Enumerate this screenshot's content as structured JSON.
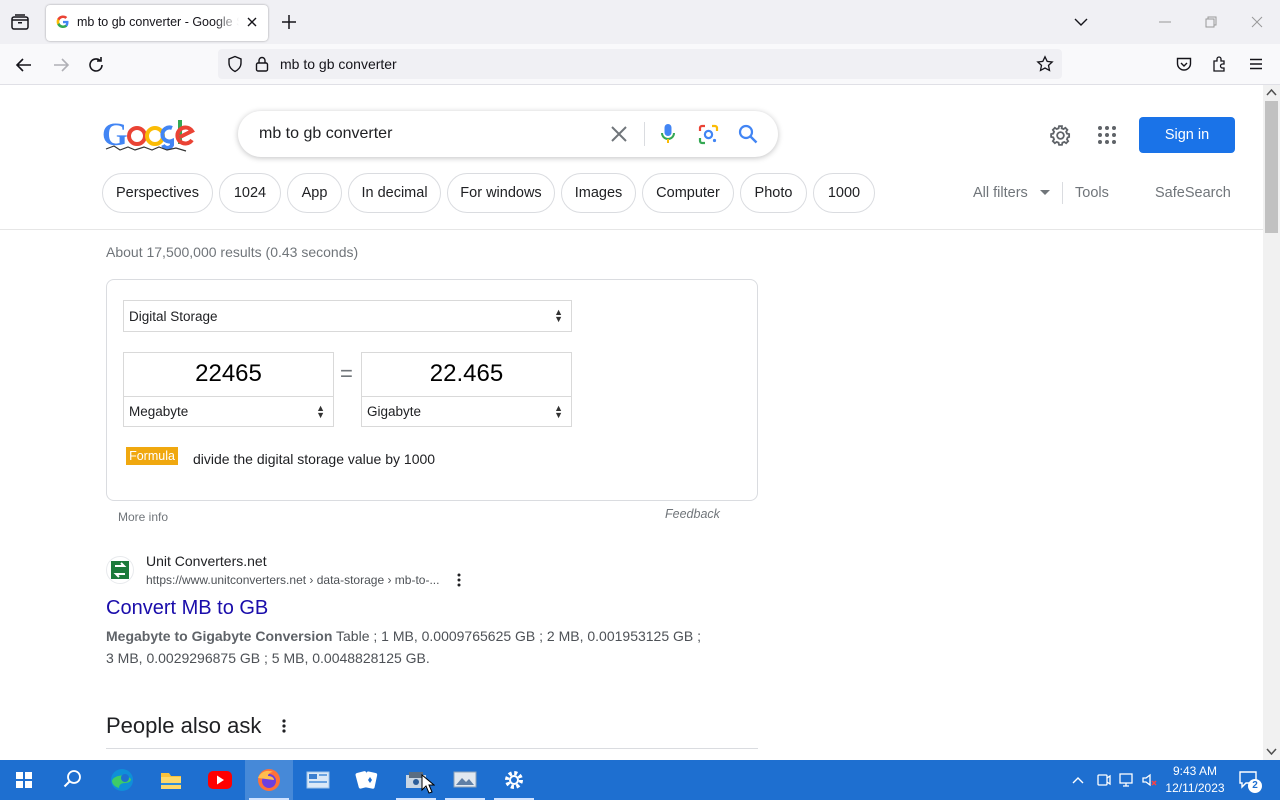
{
  "browser": {
    "tab_title": "mb to gb converter - Google Search",
    "url": "mb to gb converter"
  },
  "google": {
    "query": "mb to gb converter",
    "sign_in": "Sign in",
    "chips": [
      "Perspectives",
      "1024",
      "App",
      "In decimal",
      "For windows",
      "Images",
      "Computer",
      "Photo",
      "1000"
    ],
    "all_filters": "All filters",
    "tools": "Tools",
    "safesearch": "SafeSearch",
    "result_stats": "About 17,500,000 results (0.43 seconds)"
  },
  "converter": {
    "category": "Digital Storage",
    "from_value": "22465",
    "to_value": "22.465",
    "equals": "=",
    "from_unit": "Megabyte",
    "to_unit": "Gigabyte",
    "formula_label": "Formula",
    "formula_text": "divide the digital storage value by 1000",
    "more_info": "More info",
    "feedback": "Feedback"
  },
  "result": {
    "site_name": "Unit Converters.net",
    "site_url": "https://www.unitconverters.net › data-storage › mb-to-...",
    "title": "Convert MB to GB",
    "snippet_bold": "Megabyte to Gigabyte Conversion",
    "snippet_rest": " Table ; 1 MB, 0.0009765625 GB ; 2 MB, 0.001953125 GB ; 3 MB, 0.0029296875 GB ; 5 MB, 0.0048828125 GB."
  },
  "people_also_ask": "People also ask",
  "taskbar": {
    "time": "9:43 AM",
    "date": "12/11/2023",
    "notifications": "2"
  },
  "colors": {
    "google_blue": "#1a73e8",
    "link": "#1a0dab",
    "taskbar": "#1e6fd0",
    "formula_badge": "#f0a80f"
  }
}
